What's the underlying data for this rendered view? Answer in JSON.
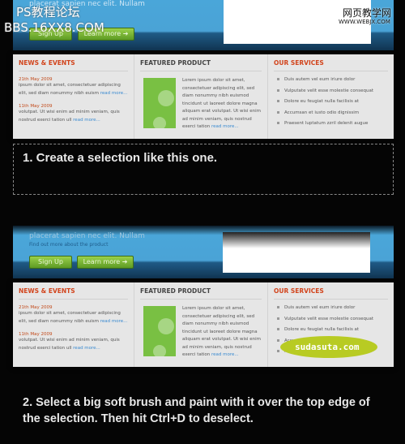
{
  "hero": {
    "tagline": "placerat sapien nec elit. Nullam",
    "find": "Find out more about the product",
    "signup": "Sign Up",
    "learn": "Learn more ➔"
  },
  "panel": {
    "news": {
      "title": "NEWS & EVENTS",
      "items": [
        {
          "date": "21th May 2009",
          "text": "ipsum dolor sit amet, consectetuer adipiscing elit, sed diam nonummy nibh euism",
          "more": "read more..."
        },
        {
          "date": "11th May 2009",
          "text": "volutpat. Ut wisi enim ad minim veniam, quis nostrud exerci tation ull",
          "more": "read more..."
        }
      ]
    },
    "featured": {
      "title": "FEATURED PRODUCT",
      "text": "Lorem ipsum dolor sit amet, consectetuer adipiscing elit, sed diam nonummy nibh euismod tincidunt ut laoreet dolore magna aliquam erat volutpat. Ut wisi enim ad minim veniam, quis nostrud exerci tation",
      "more": "read more..."
    },
    "services": {
      "title": "OUR SERVICES",
      "items": [
        "Duis autem vel eum iriure dolor",
        "Vulputate velit esse molestie consequat",
        "Dolore eu feugiat nulla facilisis at",
        "Accumsan et iusto odio dignissim",
        "Praesent luptatum zzril delenit augue"
      ]
    }
  },
  "steps": {
    "step1": "1. Create a selection like this one.",
    "step2": "2. Select a big soft brush and paint with it over the top edge of the selection. Then hit Ctrl+D to deselect."
  },
  "watermarks": {
    "ps": "PS教程论坛",
    "bbs": "BBS.16XX8.COM",
    "webjx": "网页教学网",
    "webjx_url": "WWW.WEBJX.COM",
    "sudasuta": "sudasuta.com"
  }
}
